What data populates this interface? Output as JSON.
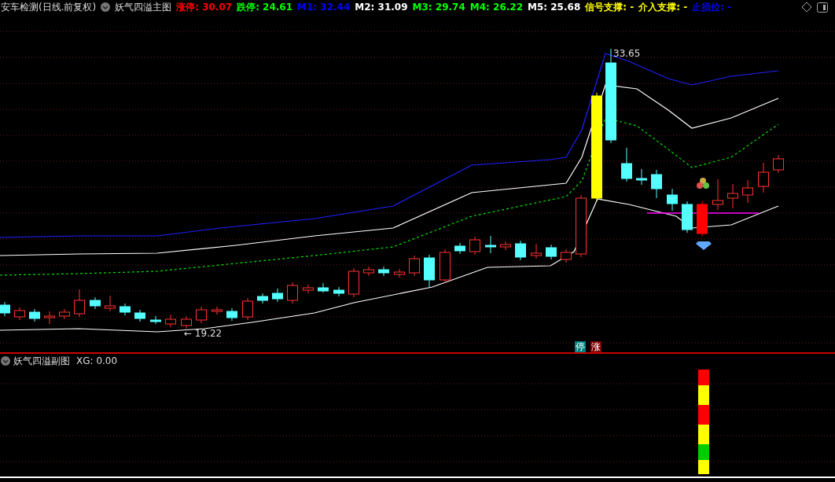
{
  "header": {
    "title": "安车检测(日线.前复权)",
    "indicator": "妖气四溢主图",
    "values": [
      {
        "text": "涨停: 30.07",
        "color": "#ff0000"
      },
      {
        "text": "跌停: 24.61",
        "color": "#00ff00"
      },
      {
        "text": "M1: 32.44",
        "color": "#0000ff"
      },
      {
        "text": "M2: 31.09",
        "color": "#ffffff"
      },
      {
        "text": "M3: 29.74",
        "color": "#00ff00"
      },
      {
        "text": "M4: 26.22",
        "color": "#00ff00"
      },
      {
        "text": "M5: 25.68",
        "color": "#ffffff"
      },
      {
        "text": "信号支撑: -",
        "color": "#ffff00"
      },
      {
        "text": "介入支撑: -",
        "color": "#ffff00"
      },
      {
        "text": "止损位: -",
        "color": "#0000ff"
      }
    ]
  },
  "chart": {
    "high_label": "33.65",
    "low_label": "← 19.22",
    "signals": [
      {
        "text": "停",
        "color": "#008080"
      },
      {
        "text": "涨",
        "color": "#800000"
      }
    ]
  },
  "sub_chart": {
    "title": "妖气四溢副图",
    "reading": "XG: 0.00"
  }
}
